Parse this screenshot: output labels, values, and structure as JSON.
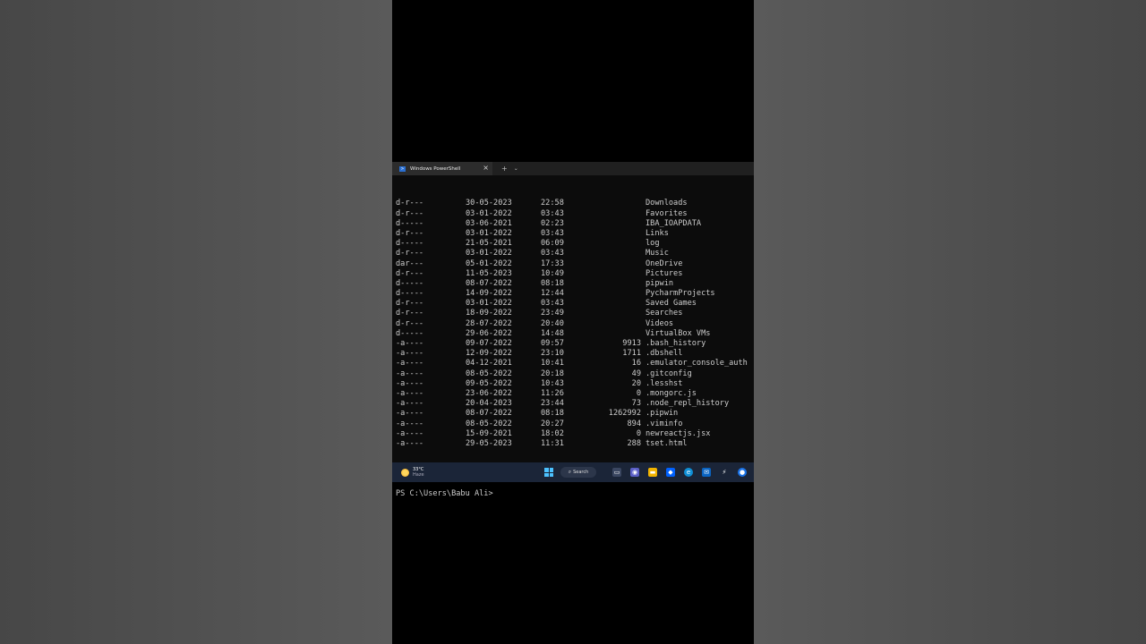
{
  "tab": {
    "title": "Windows PowerShell",
    "icon": "powershell-icon",
    "close_icon": "close-icon",
    "new_tab_icon": "plus-icon",
    "dropdown_icon": "chevron-down-icon"
  },
  "listing": [
    {
      "mode": "d-r---",
      "date": "30-05-2023",
      "time": "22:58",
      "length": "",
      "name": "Downloads"
    },
    {
      "mode": "d-r---",
      "date": "03-01-2022",
      "time": "03:43",
      "length": "",
      "name": "Favorites"
    },
    {
      "mode": "d-----",
      "date": "03-06-2021",
      "time": "02:23",
      "length": "",
      "name": "IBA_IOAPDATA"
    },
    {
      "mode": "d-r---",
      "date": "03-01-2022",
      "time": "03:43",
      "length": "",
      "name": "Links"
    },
    {
      "mode": "d-----",
      "date": "21-05-2021",
      "time": "06:09",
      "length": "",
      "name": "log"
    },
    {
      "mode": "d-r---",
      "date": "03-01-2022",
      "time": "03:43",
      "length": "",
      "name": "Music"
    },
    {
      "mode": "dar---",
      "date": "05-01-2022",
      "time": "17:33",
      "length": "",
      "name": "OneDrive"
    },
    {
      "mode": "d-r---",
      "date": "11-05-2023",
      "time": "10:49",
      "length": "",
      "name": "Pictures"
    },
    {
      "mode": "d-----",
      "date": "08-07-2022",
      "time": "08:18",
      "length": "",
      "name": "pipwin"
    },
    {
      "mode": "d-----",
      "date": "14-09-2022",
      "time": "12:44",
      "length": "",
      "name": "PycharmProjects"
    },
    {
      "mode": "d-r---",
      "date": "03-01-2022",
      "time": "03:43",
      "length": "",
      "name": "Saved Games"
    },
    {
      "mode": "d-r---",
      "date": "18-09-2022",
      "time": "23:49",
      "length": "",
      "name": "Searches"
    },
    {
      "mode": "d-r---",
      "date": "28-07-2022",
      "time": "20:40",
      "length": "",
      "name": "Videos"
    },
    {
      "mode": "d-----",
      "date": "29-06-2022",
      "time": "14:48",
      "length": "",
      "name": "VirtualBox VMs"
    },
    {
      "mode": "-a----",
      "date": "09-07-2022",
      "time": "09:57",
      "length": "9913",
      "name": ".bash_history"
    },
    {
      "mode": "-a----",
      "date": "12-09-2022",
      "time": "23:10",
      "length": "1711",
      "name": ".dbshell"
    },
    {
      "mode": "-a----",
      "date": "04-12-2021",
      "time": "10:41",
      "length": "16",
      "name": ".emulator_console_auth"
    },
    {
      "mode": "-a----",
      "date": "08-05-2022",
      "time": "20:18",
      "length": "49",
      "name": ".gitconfig"
    },
    {
      "mode": "-a----",
      "date": "09-05-2022",
      "time": "10:43",
      "length": "20",
      "name": ".lesshst"
    },
    {
      "mode": "-a----",
      "date": "23-06-2022",
      "time": "11:26",
      "length": "0",
      "name": ".mongorc.js"
    },
    {
      "mode": "-a----",
      "date": "20-04-2023",
      "time": "23:44",
      "length": "73",
      "name": ".node_repl_history"
    },
    {
      "mode": "-a----",
      "date": "08-07-2022",
      "time": "08:18",
      "length": "1262992",
      "name": ".pipwin"
    },
    {
      "mode": "-a----",
      "date": "08-05-2022",
      "time": "20:27",
      "length": "894",
      "name": ".viminfo"
    },
    {
      "mode": "-a----",
      "date": "15-09-2021",
      "time": "18:02",
      "length": "0",
      "name": "newreactjs.jsx"
    },
    {
      "mode": "-a----",
      "date": "29-05-2023",
      "time": "11:31",
      "length": "288",
      "name": "tset.html"
    }
  ],
  "prompt": "PS C:\\Users\\Babu Ali>",
  "taskbar": {
    "weather_temp": "33°C",
    "weather_condition": "Haze",
    "search_label": "Search",
    "icons": [
      "windows-start-icon",
      "search-icon",
      "task-view-icon",
      "teams-icon",
      "file-explorer-icon",
      "dropbox-icon",
      "edge-icon",
      "mail-icon",
      "terminal-icon",
      "chrome-icon"
    ]
  },
  "colors": {
    "terminal_bg": "#0c0c0c",
    "terminal_text": "#cccccc",
    "taskbar_bg": "#1b2538",
    "accent": "#2a6fd1"
  }
}
